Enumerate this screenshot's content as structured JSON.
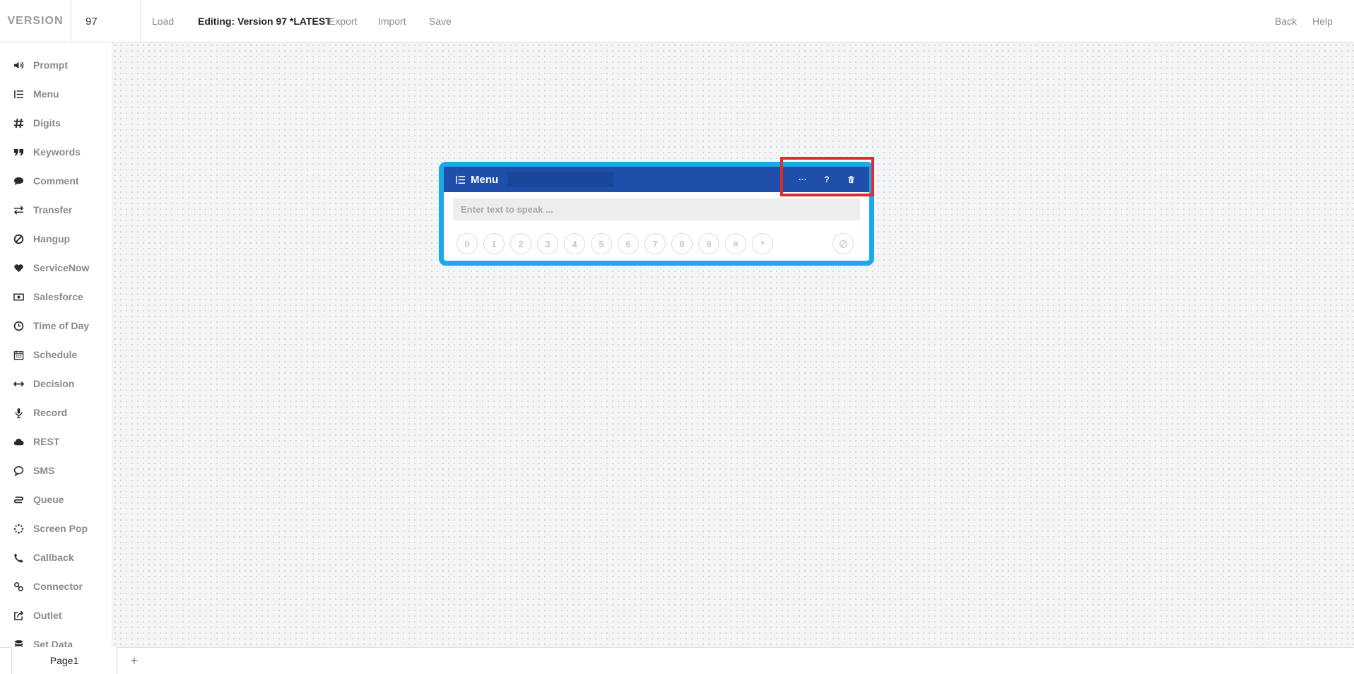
{
  "topbar": {
    "brand": "VERSION",
    "version_value": "97",
    "load": "Load",
    "editing": "Editing: Version 97 *LATEST",
    "export": "Export",
    "import": "Import",
    "save": "Save",
    "back": "Back",
    "help": "Help"
  },
  "sidebar": {
    "items": [
      {
        "label": "Prompt",
        "icon": "speaker-icon"
      },
      {
        "label": "Menu",
        "icon": "list-icon"
      },
      {
        "label": "Digits",
        "icon": "hash-icon"
      },
      {
        "label": "Keywords",
        "icon": "quote-icon"
      },
      {
        "label": "Comment",
        "icon": "comment-icon"
      },
      {
        "label": "Transfer",
        "icon": "transfer-icon"
      },
      {
        "label": "Hangup",
        "icon": "ban-icon"
      },
      {
        "label": "ServiceNow",
        "icon": "heart-icon"
      },
      {
        "label": "Salesforce",
        "icon": "money-icon"
      },
      {
        "label": "Time of Day",
        "icon": "clock-icon"
      },
      {
        "label": "Schedule",
        "icon": "calendar-icon"
      },
      {
        "label": "Decision",
        "icon": "arrows-horizontal-icon"
      },
      {
        "label": "Record",
        "icon": "microphone-icon"
      },
      {
        "label": "REST",
        "icon": "cloud-icon"
      },
      {
        "label": "SMS",
        "icon": "chat-bubble-icon"
      },
      {
        "label": "Queue",
        "icon": "queue-icon"
      },
      {
        "label": "Screen Pop",
        "icon": "spinner-icon"
      },
      {
        "label": "Callback",
        "icon": "phone-icon"
      },
      {
        "label": "Connector",
        "icon": "link-icon"
      },
      {
        "label": "Outlet",
        "icon": "share-icon"
      },
      {
        "label": "Set Data",
        "icon": "database-icon"
      }
    ]
  },
  "node": {
    "title": "Menu",
    "icon": "list-icon",
    "name_value": "",
    "more_label": "···",
    "help_label": "?",
    "speak_placeholder": "Enter text to speak ...",
    "digits": [
      "0",
      "1",
      "2",
      "3",
      "4",
      "5",
      "6",
      "7",
      "8",
      "9",
      "#",
      "*"
    ],
    "no_input_icon": "ban-icon",
    "header_color": "#1e50ab",
    "border_color": "#1aa9ec",
    "highlight_color": "#e02b2b"
  },
  "pagebar": {
    "tab": "Page1",
    "add": "+"
  }
}
